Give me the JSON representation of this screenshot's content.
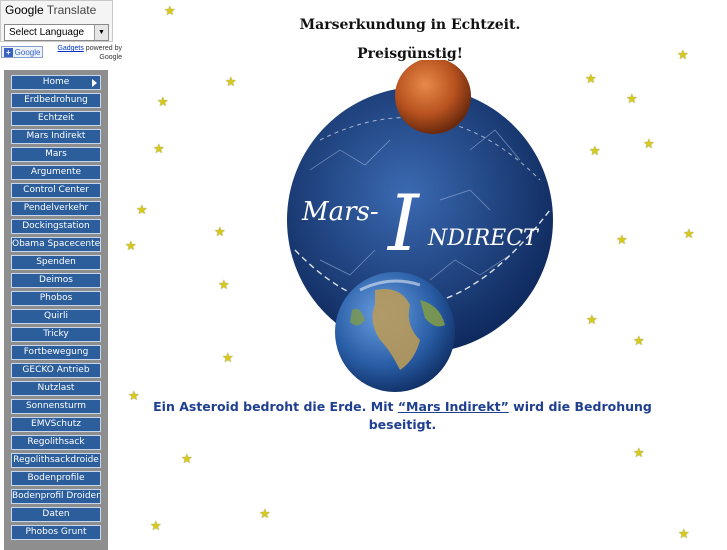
{
  "translate": {
    "brand": "Google",
    "product": "Translate",
    "select_label": "Select Language",
    "add_google": "Google",
    "gadgets_link": "Gadgets",
    "powered_by": "powered by",
    "powered_by_brand": "Google"
  },
  "sidebar": {
    "items": [
      {
        "label": "Home"
      },
      {
        "label": "Erdbedrohung"
      },
      {
        "label": "Echtzeit"
      },
      {
        "label": "Mars Indirekt"
      },
      {
        "label": "Mars"
      },
      {
        "label": "Argumente"
      },
      {
        "label": "Control Center"
      },
      {
        "label": "Pendelverkehr"
      },
      {
        "label": "Dockingstation"
      },
      {
        "label": "Obama Spacecenter"
      },
      {
        "label": "Spenden"
      },
      {
        "label": "Deimos"
      },
      {
        "label": "Phobos"
      },
      {
        "label": "Quirli"
      },
      {
        "label": "Tricky"
      },
      {
        "label": "Fortbewegung"
      },
      {
        "label": "GECKO Antrieb"
      },
      {
        "label": "Nutzlast"
      },
      {
        "label": "Sonnensturm"
      },
      {
        "label": "EMVSchutz"
      },
      {
        "label": "Regolithsack"
      },
      {
        "label": "Regolithsackdroide"
      },
      {
        "label": "Bodenprofile"
      },
      {
        "label": "Bodenprofil Droiden"
      },
      {
        "label": "Daten"
      },
      {
        "label": "Phobos Grunt"
      }
    ]
  },
  "main": {
    "heading": "Marserkundung in Echtzeit.",
    "subheading": "Preisgünstig!",
    "logo_text_mars": "Mars-",
    "logo_text_i": "I",
    "logo_text_ndirect": "NDIRECT",
    "caption_part1": "Ein Asteroid bedroht die Erde. Mit ",
    "caption_link": "“Mars Indirekt”",
    "caption_part2": " wird die Bedrohung",
    "caption_part3": "beseitigt."
  },
  "colors": {
    "nav_bg": "#2c5e9c",
    "sidebar_bg": "#8e8e8e",
    "caption": "#1f3f8f",
    "star": "#d9c91a"
  }
}
